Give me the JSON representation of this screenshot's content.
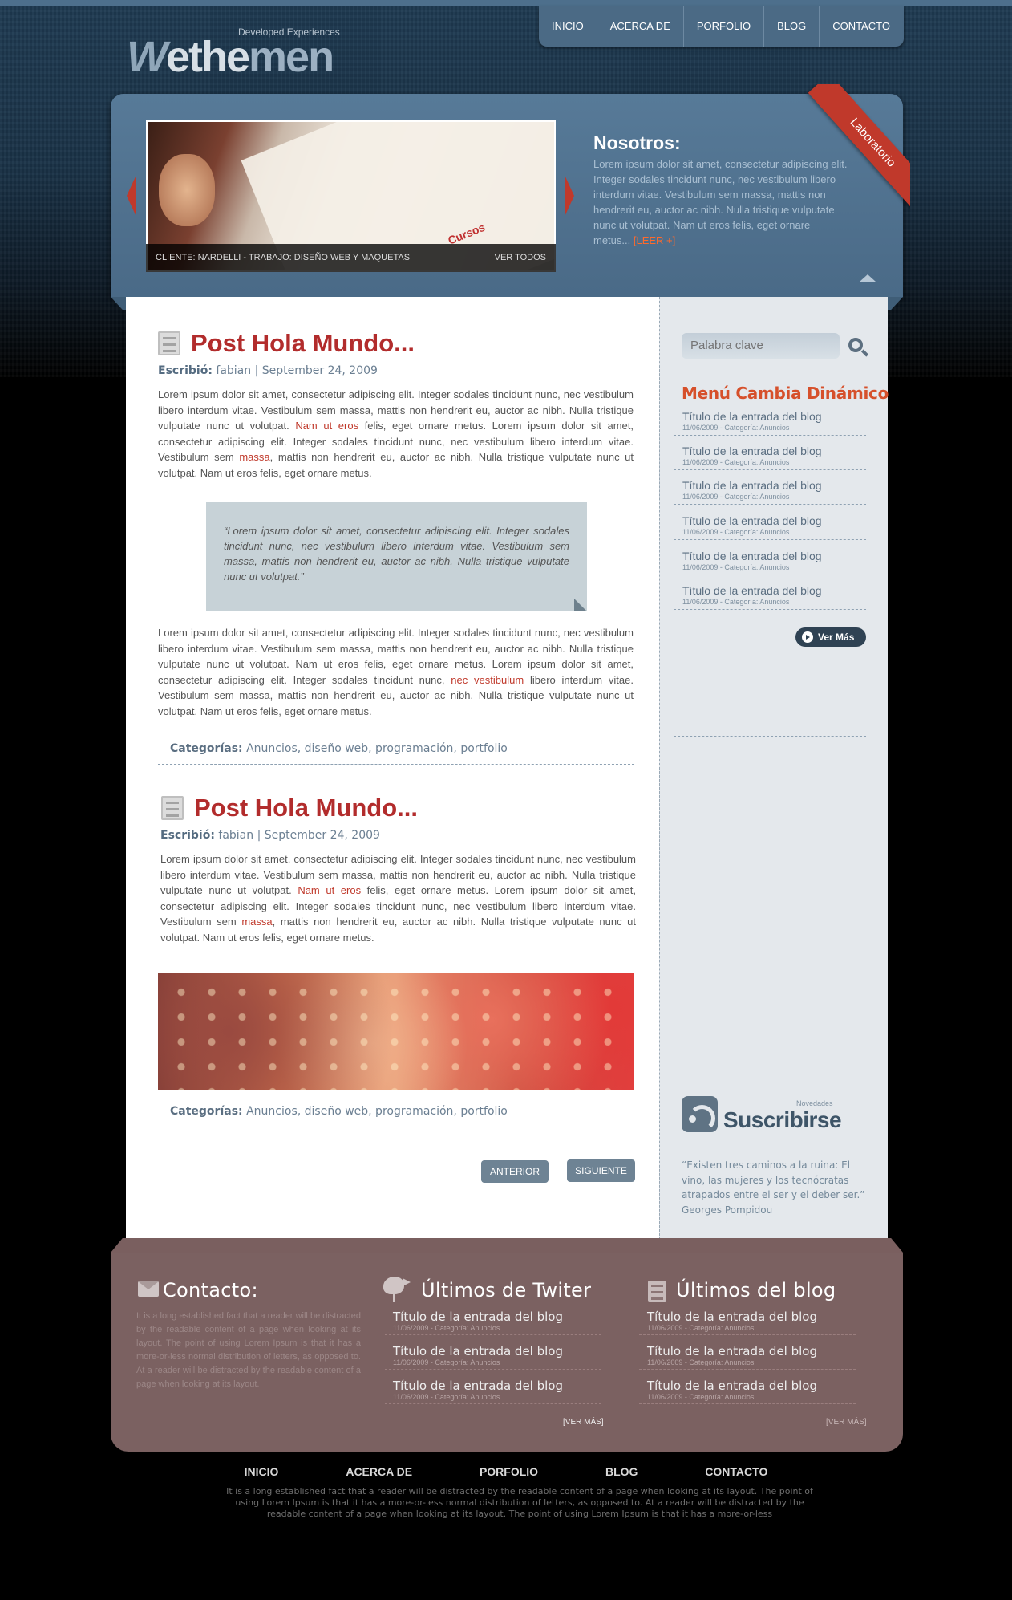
{
  "brand": {
    "tagline": "Developed Experiences",
    "name_w": "W",
    "name_a": "ethe",
    "name_b": "men"
  },
  "nav": [
    "INICIO",
    "ACERCA DE",
    "PORFOLIO",
    "BLOG",
    "CONTACTO"
  ],
  "hero": {
    "caption": "CLIENTE: NARDELLI - TRABAJO: DISEÑO WEB Y MAQUETAS",
    "caption_link": "VER TODOS",
    "image_text": "Cursos",
    "title": "Nosotros:",
    "text": "Lorem ipsum dolor sit amet, consectetur adipiscing elit. Integer sodales tincidunt nunc, nec vestibulum libero interdum vitae. Vestibulum sem massa, mattis non hendrerit eu, auctor ac nibh. Nulla tristique vulputate nunc ut volutpat. Nam ut eros felis, eget ornare metus...",
    "more": "[LEER +]",
    "ribbon": "Laboratorio"
  },
  "posts": [
    {
      "title": "Post Hola Mundo...",
      "meta_label": "Escribió:",
      "meta": "fabian | September 24, 2009",
      "p1a": "Lorem ipsum dolor sit amet, consectetur adipiscing elit. Integer sodales tincidunt nunc, nec vestibulum libero interdum vitae. Vestibulum sem massa, mattis non hendrerit eu, auctor ac nibh. Nulla tristique vulputate nunc ut volutpat. ",
      "p1link": "Nam ut eros",
      "p1b": " felis, eget ornare metus. Lorem ipsum dolor sit amet, consectetur adipiscing elit. Integer sodales tincidunt nunc, nec vestibulum libero interdum vitae. Vestibulum sem ",
      "p1link2": "massa",
      "p1c": ", mattis non hendrerit eu, auctor ac nibh. Nulla tristique vulputate nunc ut volutpat. Nam ut eros felis, eget ornare metus.",
      "quote": "“Lorem ipsum dolor sit amet, consectetur adipiscing elit. Integer sodales tincidunt nunc, nec vestibulum libero interdum vitae. Vestibulum sem massa, mattis non hendrerit eu, auctor ac nibh. Nulla tristique vulputate nunc ut volutpat.”",
      "p2a": "Lorem ipsum dolor sit amet, consectetur adipiscing elit. Integer sodales tincidunt nunc, nec vestibulum libero interdum vitae. Vestibulum sem massa, mattis non hendrerit eu, auctor ac nibh. Nulla tristique vulputate nunc ut volutpat. Nam ut eros felis, eget ornare metus. Lorem ipsum dolor sit amet, consectetur adipiscing elit. Integer sodales tincidunt nunc, ",
      "p2link": "nec vestibulum",
      "p2b": " libero interdum vitae. Vestibulum sem massa, mattis non hendrerit eu, auctor ac nibh. Nulla tristique vulputate nunc ut volutpat. Nam ut eros felis, eget ornare metus.",
      "cats_label": "Categorías:",
      "cats": "Anuncios, diseño web, programación, portfolio"
    },
    {
      "title": "Post Hola Mundo...",
      "meta_label": "Escribió:",
      "meta": "fabian | September 24, 2009",
      "p1a": "Lorem ipsum dolor sit amet, consectetur adipiscing elit. Integer sodales tincidunt nunc, nec vestibulum libero interdum vitae. Vestibulum sem massa, mattis non hendrerit eu, auctor ac nibh. Nulla tristique vulputate nunc ut volutpat. ",
      "p1link": "Nam ut eros",
      "p1b": " felis, eget ornare metus. Lorem ipsum dolor sit amet, consectetur adipiscing elit. Integer sodales tincidunt nunc, nec vestibulum libero interdum vitae. Vestibulum sem ",
      "p1link2": "massa",
      "p1c": ", mattis non hendrerit eu, auctor ac nibh. Nulla tristique vulputate nunc ut volutpat. Nam ut eros felis, eget ornare metus.",
      "cats_label": "Categorías:",
      "cats": "Anuncios, diseño web, programación, portfolio"
    }
  ],
  "pager": {
    "prev": "ANTERIOR",
    "next": "SIGUIENTE"
  },
  "sidebar": {
    "search_placeholder": "Palabra clave",
    "menu_title": "Menú Cambia Dinámico",
    "items": [
      {
        "title": "Título de la entrada del blog",
        "date": "11/06/2009 - Categoría: Anuncios"
      },
      {
        "title": "Título de la entrada del blog",
        "date": "11/06/2009 - Categoría: Anuncios"
      },
      {
        "title": "Título de la entrada del blog",
        "date": "11/06/2009 - Categoría: Anuncios"
      },
      {
        "title": "Título de la entrada del blog",
        "date": "11/06/2009 - Categoría: Anuncios"
      },
      {
        "title": "Título de la entrada del blog",
        "date": "11/06/2009 - Categoría: Anuncios"
      },
      {
        "title": "Título de la entrada del blog",
        "date": "11/06/2009 - Categoría: Anuncios"
      }
    ],
    "ver_mas": "Ver Más",
    "subscribe_small": "Novedades",
    "subscribe": "Suscribirse",
    "quote": "“Existen tres caminos a la ruina: El vino, las mujeres y los tecnócratas atrapados entre el ser y el deber ser.” Georges Pompidou"
  },
  "footer": {
    "contact_title": "Contacto:",
    "contact_text": "It is a long established fact that a reader will be distracted by the readable content of a page when looking at its layout. The point of using Lorem Ipsum is that it has a more-or-less normal distribution of letters, as opposed to. At a reader will be distracted by the readable content of a page when looking at its layout.",
    "twitter_title": "Últimos de Twiter",
    "blog_title": "Últimos del blog",
    "twitter_items": [
      {
        "title": "Título de la entrada del blog",
        "date": "11/06/2009 - Categoría: Anuncios"
      },
      {
        "title": "Título de la entrada del blog",
        "date": "11/06/2009 - Categoría: Anuncios"
      },
      {
        "title": "Título de la entrada del blog",
        "date": "11/06/2009 - Categoría: Anuncios"
      }
    ],
    "blog_items": [
      {
        "title": "Título de la entrada del blog",
        "date": "11/06/2009 - Categoría: Anuncios"
      },
      {
        "title": "Título de la entrada del blog",
        "date": "11/06/2009 - Categoría: Anuncios"
      },
      {
        "title": "Título de la entrada del blog",
        "date": "11/06/2009 - Categoría: Anuncios"
      }
    ],
    "ver_mas": "[VER MÁS]"
  },
  "bottom_nav": [
    "INICIO",
    "ACERCA DE",
    "PORFOLIO",
    "BLOG",
    "CONTACTO"
  ],
  "legal": "It is a long established fact that a reader will be distracted by the readable content of a page when looking at its layout. The point of using Lorem Ipsum is that it has a more-or-less normal distribution of letters, as opposed to. At a reader will be distracted by the readable content of a page when looking at its layout. The point of using Lorem Ipsum is that it has a more-or-less"
}
